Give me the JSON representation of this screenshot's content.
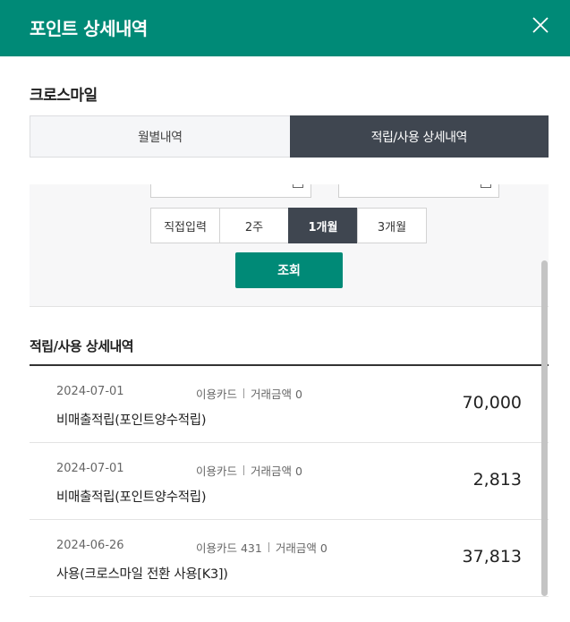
{
  "header": {
    "title": "포인트 상세내역"
  },
  "section": {
    "title": "크로스마일"
  },
  "tabs": [
    {
      "label": "월별내역",
      "active": false
    },
    {
      "label": "적립/사용 상세내역",
      "active": true
    }
  ],
  "filter": {
    "period_buttons": [
      {
        "label": "직접입력",
        "active": false
      },
      {
        "label": "2주",
        "active": false
      },
      {
        "label": "1개월",
        "active": true
      },
      {
        "label": "3개월",
        "active": false
      }
    ],
    "search_label": "조회"
  },
  "list": {
    "title": "적립/사용 상세내역",
    "transactions": [
      {
        "date": "2024-07-01",
        "card_label": "이용카드",
        "amount_label": "거래금액 0",
        "description": "비매출적립(포인트양수적립)",
        "points": "70,000"
      },
      {
        "date": "2024-07-01",
        "card_label": "이용카드",
        "amount_label": "거래금액 0",
        "description": "비매출적립(포인트양수적립)",
        "points": "2,813"
      },
      {
        "date": "2024-06-26",
        "card_label": "이용카드 431",
        "amount_label": "거래금액 0",
        "description": "사용(크로스마일 전환 사용[K3])",
        "points": "37,813"
      }
    ]
  },
  "colors": {
    "brand": "#008a77",
    "active_tab": "#3f4650"
  }
}
